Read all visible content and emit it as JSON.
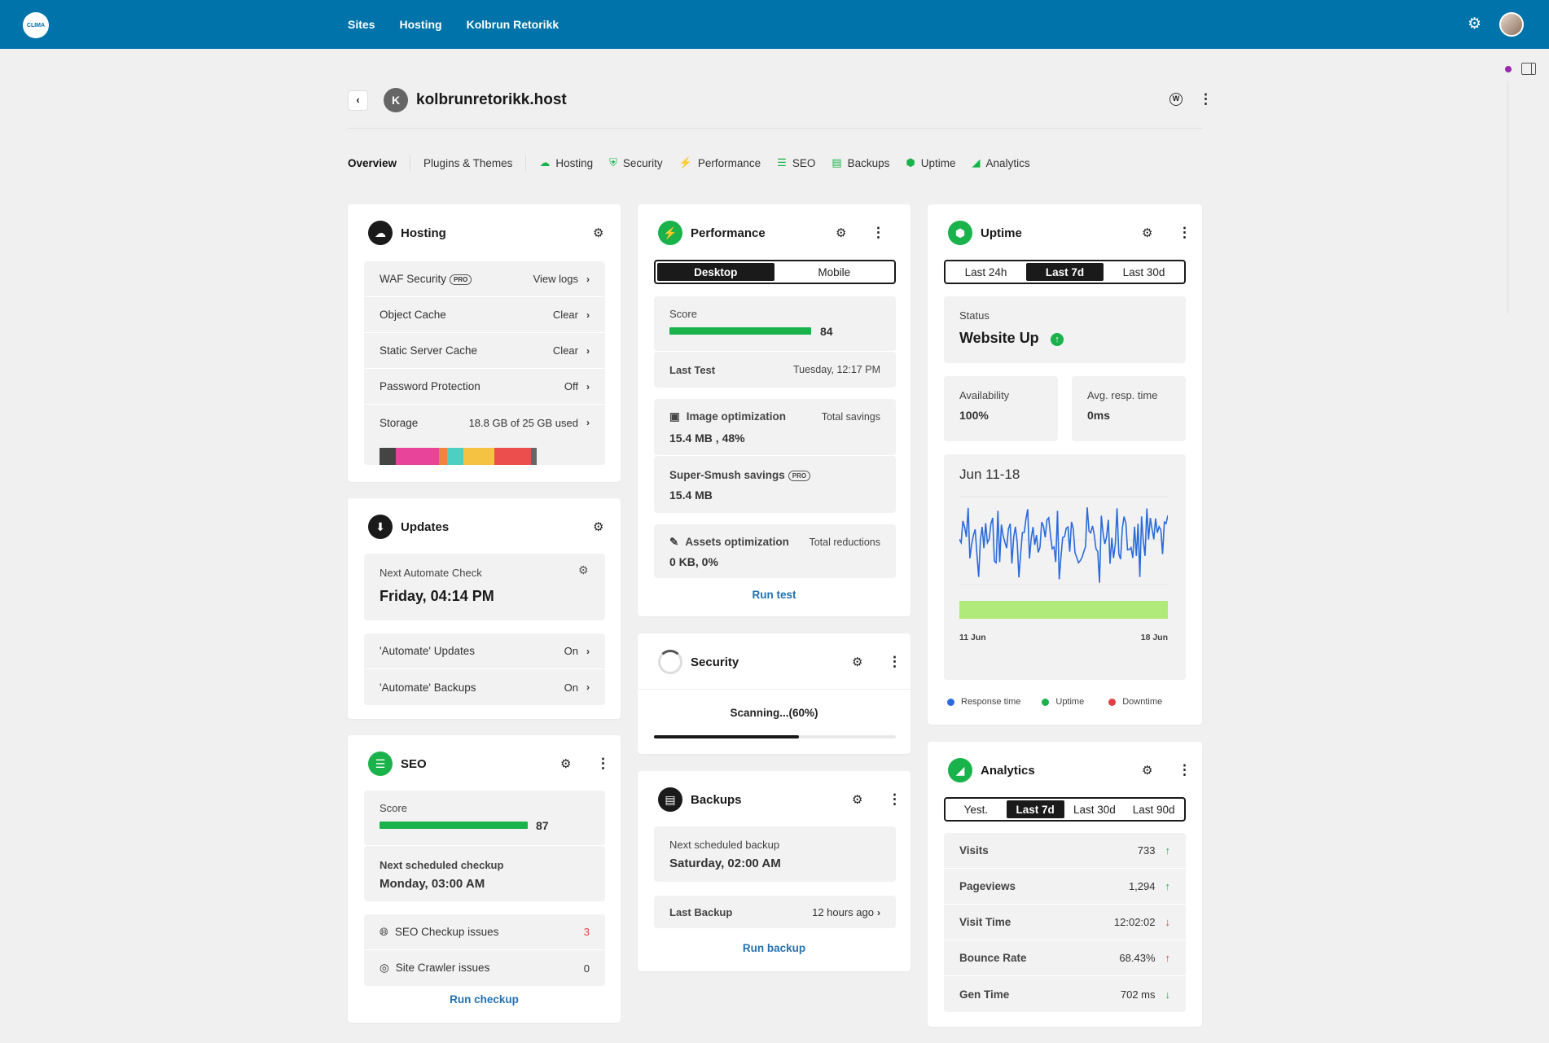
{
  "topbar": {
    "logo_text": "CLIMA",
    "nav": [
      "Sites",
      "Hosting",
      "Kolbrun Retorikk"
    ],
    "settings_icon": "gear-icon",
    "avatar_icon": "user-avatar"
  },
  "site": {
    "initial": "K",
    "title": "kolbrunretorikk.host",
    "wp_icon": "W"
  },
  "tabs": [
    {
      "label": "Overview",
      "icon": ""
    },
    {
      "label": "Plugins & Themes",
      "icon": ""
    },
    {
      "label": "Hosting",
      "icon": "cloud-icon"
    },
    {
      "label": "Security",
      "icon": "shield-icon"
    },
    {
      "label": "Performance",
      "icon": "bolt-icon"
    },
    {
      "label": "SEO",
      "icon": "seo-icon"
    },
    {
      "label": "Backups",
      "icon": "backups-icon"
    },
    {
      "label": "Uptime",
      "icon": "uptime-icon"
    },
    {
      "label": "Analytics",
      "icon": "analytics-icon"
    }
  ],
  "hosting": {
    "title": "Hosting",
    "rows": [
      {
        "label": "WAF Security",
        "badge": "PRO",
        "action": "View logs"
      },
      {
        "label": "Object Cache",
        "action": "Clear"
      },
      {
        "label": "Static Server Cache",
        "action": "Clear"
      },
      {
        "label": "Password Protection",
        "action": "Off"
      }
    ],
    "storage": {
      "label": "Storage",
      "value": "18.8 GB of 25 GB used",
      "used_fraction": 0.752
    }
  },
  "updates": {
    "title": "Updates",
    "next_label": "Next Automate Check",
    "next_value": "Friday, 04:14 PM",
    "rows": [
      {
        "label": "'Automate' Updates",
        "value": "On"
      },
      {
        "label": "'Automate' Backups",
        "value": "On"
      }
    ]
  },
  "seo": {
    "title": "SEO",
    "score_label": "Score",
    "score": "87",
    "next_label": "Next scheduled checkup",
    "next_value": "Monday, 03:00 AM",
    "rows": [
      {
        "label": "SEO Checkup issues",
        "value": "3"
      },
      {
        "label": "Site Crawler issues",
        "value": "0"
      }
    ],
    "action": "Run checkup"
  },
  "performance": {
    "title": "Performance",
    "segments": [
      "Desktop",
      "Mobile"
    ],
    "score_label": "Score",
    "score": "84",
    "last_test_label": "Last Test",
    "last_test_value": "Tuesday, 12:17 PM",
    "image_label": "Image optimization",
    "image_right": "Total savings",
    "image_value": "15.4 MB , 48%",
    "smush_label": "Super-Smush savings",
    "smush_badge": "PRO",
    "smush_value": "15.4 MB",
    "assets_label": "Assets optimization",
    "assets_right": "Total reductions",
    "assets_value": "0 KB, 0%",
    "action": "Run test"
  },
  "security": {
    "title": "Security",
    "status": "Scanning...(60%)",
    "progress": 0.6
  },
  "backups": {
    "title": "Backups",
    "next_label": "Next scheduled backup",
    "next_value": "Saturday, 02:00 AM",
    "last_label": "Last Backup",
    "last_value": "12 hours ago",
    "action": "Run backup"
  },
  "uptime": {
    "title": "Uptime",
    "segments": [
      "Last 24h",
      "Last 7d",
      "Last 30d"
    ],
    "status_label": "Status",
    "status_value": "Website Up",
    "availability_label": "Availability",
    "availability_value": "100%",
    "resp_label": "Avg. resp. time",
    "resp_value": "0ms",
    "chart_title": "Jun 11-18",
    "x_start": "11 Jun",
    "x_end": "18 Jun",
    "legend": [
      {
        "label": "Response time",
        "color": "#2b6bdc"
      },
      {
        "label": "Uptime",
        "color": "#1ab24b"
      },
      {
        "label": "Downtime",
        "color": "#e04040"
      }
    ]
  },
  "analytics": {
    "title": "Analytics",
    "segments": [
      "Yest.",
      "Last 7d",
      "Last 30d",
      "Last 90d"
    ],
    "rows": [
      {
        "label": "Visits",
        "value": "733",
        "trend": "up-good"
      },
      {
        "label": "Pageviews",
        "value": "1,294",
        "trend": "up-good"
      },
      {
        "label": "Visit Time",
        "value": "12:02:02",
        "trend": "down-bad"
      },
      {
        "label": "Bounce Rate",
        "value": "68.43%",
        "trend": "up-bad"
      },
      {
        "label": "Gen Time",
        "value": "702 ms",
        "trend": "down-good"
      }
    ]
  }
}
